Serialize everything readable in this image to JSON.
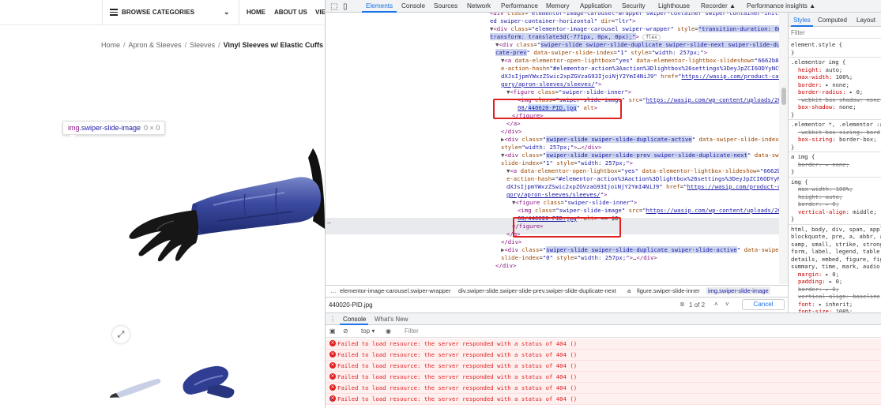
{
  "site": {
    "nav": {
      "browse": "BROWSE CATEGORIES",
      "home": "HOME",
      "about": "ABOUT US",
      "view": "VIE"
    },
    "breadcrumb": {
      "home": "Home",
      "cat": "Apron & Sleeves",
      "sub": "Sleeves",
      "current": "Vinyl Sleeves w/ Elastic Cuffs"
    },
    "tooltip": {
      "tag": "img",
      "cls": ".swiper-slide-image",
      "dims": "0 × 0"
    },
    "expand_icon": "⤢"
  },
  "devtools": {
    "tabs": [
      "Elements",
      "Console",
      "Sources",
      "Network",
      "Performance",
      "Memory",
      "Application",
      "Security",
      "Lighthouse",
      "Recorder ▲",
      "Performance insights ▲"
    ],
    "active_tab": "Elements",
    "dom_lines": [
      {
        "html": "<span class=\"t\">&lt;div</span> <span class=\"a\">class</span>=<span class=\"v\">\"elementor-image-carousel-wrapper swiper-container swiper-container-initiali</span>"
      },
      {
        "html": "<span class=\"v\">ed swiper-container-horizontal\"</span> <span class=\"a\">dir</span>=<span class=\"v\">\"ltr\"</span><span class=\"t\">&gt;</span>"
      },
      {
        "html": "<span class=\"tri\">▼</span><span class=\"t\">&lt;div</span> <span class=\"a\">class</span>=<span class=\"v\">\"elementor-image-carousel swiper-wrapper\"</span> <span class=\"a\">style</span>=<span class=\"v hlv\">\"transition-duration: 0ms;</span>"
      },
      {
        "html": "<span class=\"v hlv\">transform: translate3d(-771px, 0px, 0px);\"</span><span class=\"t\">&gt;</span> <span style=\"border:1px solid #ccc;border-radius:6px;padding:0 3px;font-size:6px;color:#555\">flex</span>"
      },
      {
        "html": "<span class=\"tri\">▼</span><span class=\"t\">&lt;div</span> <span class=\"a\">class</span>=<span class=\"v\">\"<span class=\"hlv\">swiper-slide swiper-slide-duplicate swiper-slide-next swiper-slide-dupli</span></span>"
      },
      {
        "html": "<span class=\"v\"><span class=\"hlv\">cate-prev</span>\"</span> <span class=\"a\">data-swiper-slide-index</span>=<span class=\"v\">\"1\"</span> <span class=\"a\">style</span>=<span class=\"v\">\"width: 257px;\"</span><span class=\"t\">&gt;</span>"
      },
      {
        "html": "<span class=\"tri\">▼</span><span class=\"t\">&lt;a</span> <span class=\"a\">data-elementor-open-lightbox</span>=<span class=\"v\">\"yes\"</span> <span class=\"a\">data-elementor-lightbox-slideshow</span>=<span class=\"v\">\"6662b86\"</span>"
      },
      {
        "html": "<span class=\"a\">e-action-hash</span>=<span class=\"v\">\"#elementor-action%3Aaction%3Dlightbox%26settings%3DeyJpZCI6ODYyNCwi</span>"
      },
      {
        "html": "<span class=\"v\">dXJsIjpmYWxzZSwic2xpZGVzaG93IjoiNjY2YmI4NiJ9\"</span> <span class=\"a\">href</span>=<span class=\"v\">\"</span><span class=\"u\">https://wasip.com/product-cate</span>"
      },
      {
        "html": "<span class=\"u\">gory/apron-sleeves/sleeves/</span><span class=\"v\">\"</span><span class=\"t\">&gt;</span>"
      },
      {
        "html": "<span class=\"tri\">▼</span><span class=\"t\">&lt;figure</span> <span class=\"a\">class</span>=<span class=\"v\">\"swiper-slide-inner\"</span><span class=\"t\">&gt;</span>"
      },
      {
        "html": "<span class=\"t\">&lt;img</span> <span class=\"a\">class</span>=<span class=\"v\">\"swiper-slide-image\"</span> <span class=\"a\">src</span>=<span class=\"v\">\"</span><span class=\"u\">https://wasip.com/wp-content/uploads/2021/</span>"
      },
      {
        "html": "<span class=\"u\">08/<span class=\"hl\">440020-PID.jpg</span></span><span class=\"v\">\"</span> <span class=\"a\">alt</span><span class=\"t\">&gt;</span>"
      },
      {
        "html": "<span class=\"t\">&lt;/figure&gt;</span>"
      },
      {
        "html": "<span class=\"t\">&lt;/a&gt;</span>"
      },
      {
        "html": "<span class=\"t\">&lt;/div&gt;</span>"
      },
      {
        "html": "<span class=\"tri\">▶</span><span class=\"t\">&lt;div</span> <span class=\"a\">class</span>=<span class=\"v\">\"<span class=\"hlv\">swiper-slide swiper-slide-duplicate-active</span>\"</span> <span class=\"a\">data-swiper-slide-index</span>=<span class=\"v\">\"0\"</span>"
      },
      {
        "html": "<span class=\"a\">style</span>=<span class=\"v\">\"width: 257px;\"</span><span class=\"t\">&gt;</span><span class=\"x\">…</span><span class=\"t\">&lt;/div&gt;</span>"
      },
      {
        "html": "<span class=\"tri\">▼</span><span class=\"t\">&lt;div</span> <span class=\"a\">class</span>=<span class=\"v\">\"<span class=\"hlv\">swiper-slide swiper-slide-prev swiper-slide-duplicate-next</span>\"</span> <span class=\"a\">data-swiper-</span>"
      },
      {
        "html": "<span class=\"a\">slide-index</span>=<span class=\"v\">\"1\"</span> <span class=\"a\">style</span>=<span class=\"v\">\"width: 257px;\"</span><span class=\"t\">&gt;</span>"
      },
      {
        "html": "<span class=\"tri\">▼</span><span class=\"t\">&lt;a</span> <span class=\"a\">data-elementor-open-lightbox</span>=<span class=\"v\">\"yes\"</span> <span class=\"a\">data-elementor-lightbox-slideshow</span>=<span class=\"v\">\"6662b86\"</span>"
      },
      {
        "html": "<span class=\"a\">e-action-hash</span>=<span class=\"v\">\"#elementor-action%3Aaction%3Dlightbox%26settings%3DeyJpZCI6ODYyNCwi</span>"
      },
      {
        "html": "<span class=\"v\">dXJsIjpmYWxzZSwic2xpZGVzaG93IjoiNjY2YmI4NiJ9\"</span> <span class=\"a\">href</span>=<span class=\"v\">\"</span><span class=\"u\">https://wasip.com/product-cate</span>"
      },
      {
        "html": "<span class=\"u\">gory/apron-sleeves/sleeves/</span><span class=\"v\">\"</span><span class=\"t\">&gt;</span>"
      },
      {
        "html": "<span class=\"tri\">▼</span><span class=\"t\">&lt;figure</span> <span class=\"a\">class</span>=<span class=\"v\">\"swiper-slide-inner\"</span><span class=\"t\">&gt;</span>"
      },
      {
        "html": "<span class=\"t\">&lt;img</span> <span class=\"a\">class</span>=<span class=\"v\">\"swiper-slide-image\"</span> <span class=\"a\">src</span>=<span class=\"v\">\"</span><span class=\"u\">https://wasip.com/wp-content/uploads/2021/</span>"
      },
      {
        "html": "<span class=\"u\">08/440020-PID.jpg</span><span class=\"v\">\"</span> <span class=\"a\">alt</span><span class=\"t\">&gt;</span> <span class=\"x\">== $0</span>"
      },
      {
        "html": "<span class=\"t\">&lt;/figure&gt;</span>"
      },
      {
        "html": "<span class=\"t\">&lt;/a&gt;</span>"
      },
      {
        "html": "<span class=\"t\">&lt;/div&gt;</span>"
      },
      {
        "html": "<span class=\"tri\">▶</span><span class=\"t\">&lt;div</span> <span class=\"a\">class</span>=<span class=\"v\">\"<span class=\"hlv\">swiper-slide swiper-slide-duplicate swiper-slide-active</span>\"</span> <span class=\"a\">data-swiper-</span>"
      },
      {
        "html": "<span class=\"a\">slide-index</span>=<span class=\"v\">\"0\"</span> <span class=\"a\">style</span>=<span class=\"v\">\"width: 257px;\"</span><span class=\"t\">&gt;</span><span class=\"x\">…</span><span class=\"t\">&lt;/div&gt;</span>"
      },
      {
        "html": "<span class=\"t\">&lt;/div&gt;</span>"
      }
    ],
    "breadcrumbs": [
      "…",
      "elementor-image-carousel.swiper-wrapper",
      "div.swiper-slide.swiper-slide-prev.swiper-slide-duplicate-next",
      "a",
      "figure.swiper-slide-inner",
      "img.swiper-slide-image"
    ],
    "find": {
      "query": "440020-PID.jpg",
      "count": "1 of 2",
      "cancel": "Cancel"
    },
    "drawer_tabs": {
      "console": "Console",
      "whatsnew": "What's New"
    },
    "console_toolbar": {
      "context": "top ▾",
      "filter": "Filter"
    },
    "errors": [
      "Failed to load resource: the server responded with a status of 404 ()",
      "Failed to load resource: the server responded with a status of 404 ()",
      "Failed to load resource: the server responded with a status of 404 ()",
      "Failed to load resource: the server responded with a status of 404 ()",
      "Failed to load resource: the server responded with a status of 404 ()",
      "Failed to load resource: the server responded with a status of 404 ()"
    ],
    "styles": {
      "tabs": {
        "styles": "Styles",
        "computed": "Computed",
        "layout": "Layout"
      },
      "filter": "Filter",
      "rules": [
        {
          "sel": "element.style {"
        },
        {
          "sel": "}"
        },
        {
          "sel": ".elementor img {"
        },
        {
          "prop": "height",
          "val": "auto;"
        },
        {
          "prop": "max-width",
          "val": "100%;"
        },
        {
          "prop": "border",
          "val": "▸ none;"
        },
        {
          "prop": "border-radius",
          "val": "▸ 0;"
        },
        {
          "prop": "-webkit-box-shadow",
          "val": "none;",
          "strike": true
        },
        {
          "prop": "box-shadow",
          "val": "none;"
        },
        {
          "sel": "}"
        },
        {
          "sel": ".elementor *, .elementor :a"
        },
        {
          "prop": "-webkit-box-sizing",
          "val": "bord",
          "strike": true
        },
        {
          "prop": "box-sizing",
          "val": "border-box;"
        },
        {
          "sel": "}"
        },
        {
          "sel": "a img {"
        },
        {
          "prop": "border",
          "val": "▸ none;",
          "strike": true
        },
        {
          "sel": "}"
        },
        {
          "sel": "img {"
        },
        {
          "prop": "max-width",
          "val": "100%;",
          "strike": true
        },
        {
          "prop": "height",
          "val": "auto;",
          "strike": true
        },
        {
          "prop": "border",
          "val": "▸ 0;",
          "strike": true
        },
        {
          "prop": "vertical-align",
          "val": "middle;"
        },
        {
          "sel": "}"
        },
        {
          "sel": "html, body, div, span, applet"
        },
        {
          "sel": "blockquote, pre, a, abbr, ac"
        },
        {
          "sel": "samp, small, strike, strong"
        },
        {
          "sel": "form, label, legend, table,"
        },
        {
          "sel": "details, embed, figure, figc"
        },
        {
          "sel": "summary, time, mark, audio,"
        },
        {
          "prop": "margin",
          "val": "▸ 0;"
        },
        {
          "prop": "padding",
          "val": "▸ 0;"
        },
        {
          "prop": "border",
          "val": "▸ 0;",
          "strike": true
        },
        {
          "prop": "vertical-align",
          "val": "baseline",
          "strike": true
        },
        {
          "prop": "font",
          "val": "▸ inherit;"
        },
        {
          "prop": "font-size",
          "val": "100%;"
        }
      ]
    }
  }
}
